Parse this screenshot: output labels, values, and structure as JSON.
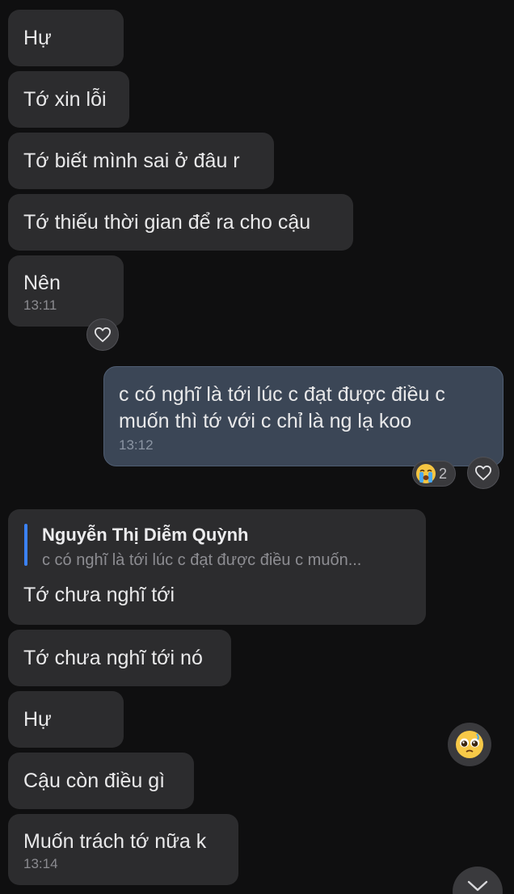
{
  "messages": [
    {
      "text": "Hự"
    },
    {
      "text": "Tớ xin lỗi"
    },
    {
      "text": "Tớ biết mình sai ở đâu r"
    },
    {
      "text": "Tớ thiếu thời gian để ra cho cậu"
    },
    {
      "text": "Nên",
      "time": "13:11"
    }
  ],
  "sent_message": {
    "line1": "c có nghĩ là tới lúc c đạt được điều c",
    "line2": "muốn thì tớ với c chỉ là ng lạ koo",
    "time": "13:12",
    "reaction_count": "2"
  },
  "reply": {
    "quoted_name": "Nguyễn Thị Diễm Quỳnh",
    "quoted_snippet": "c có nghĩ là tới lúc c đạt được điều c muốn...",
    "text": "Tớ chưa nghĩ tới"
  },
  "messages2": [
    {
      "text": "Tớ chưa nghĩ tới nó"
    },
    {
      "text": "Hự"
    },
    {
      "text": "Cậu còn điều gì"
    },
    {
      "text": "Muốn trách tớ nữa k",
      "time": "13:14"
    }
  ],
  "colors": {
    "background": "#0f0f10",
    "received_bubble": "#2c2c2e",
    "sent_bubble": "#3b4656",
    "reply_accent": "#3b82f6"
  },
  "icons": [
    "heart-icon",
    "crying-emoji-icon",
    "pleading-emoji-icon",
    "chevron-down-icon"
  ]
}
